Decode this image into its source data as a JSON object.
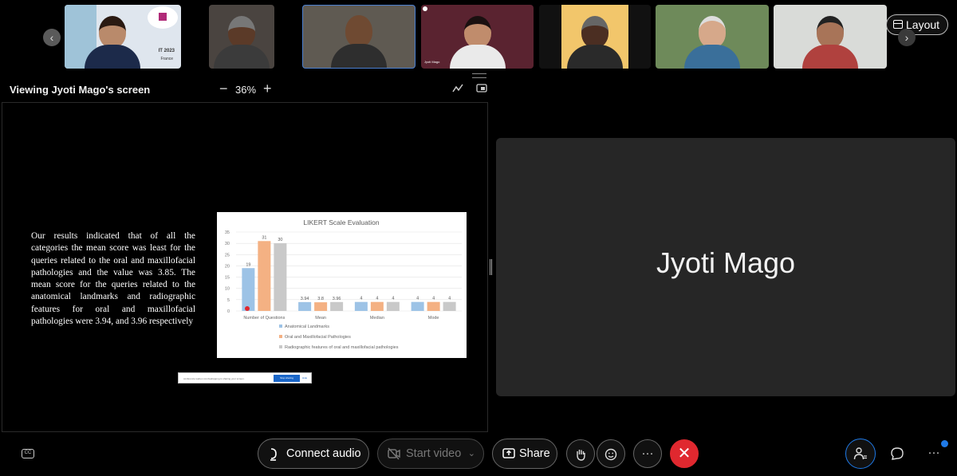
{
  "header": {
    "viewing_label": "Viewing Jyoti Mago's screen",
    "zoom_level": "36%",
    "zoom_minus": "−",
    "zoom_plus": "+",
    "layout_label": "Layout"
  },
  "filmstrip": {
    "prev_glyph": "‹",
    "next_glyph": "›",
    "tiles": [
      {
        "slide_text": "IT 2023",
        "slide_sub": "France"
      },
      {},
      {},
      {
        "caption": "Jyoti Mago"
      },
      {},
      {},
      {}
    ]
  },
  "slide": {
    "body": "Our results indicated that of all the categories the mean score was least for the queries related to the oral and maxillofacial pathologies and the value was 3.85. The mean score for the queries related to the anatomical landmarks and radiographic features for oral and maxillofacial pathologies were 3.94, and 3.96 respectively",
    "notice_text": "conference.webex.com/webappng is sharing your screen.",
    "notice_stop": "Stop sharing",
    "notice_hide": "Hide"
  },
  "chart_data": {
    "type": "bar",
    "title": "LIKERT Scale Evaluation",
    "categories": [
      "Number of Questions",
      "Mean",
      "Median",
      "Mode"
    ],
    "series": [
      {
        "name": "Anatomical Landmarks",
        "color": "#9dc3e6",
        "values": [
          19,
          3.94,
          4,
          4
        ],
        "labels": [
          "19",
          "3.94",
          "4",
          "4"
        ]
      },
      {
        "name": "Oral and Maxillofacial Pathologies",
        "color": "#f4b183",
        "values": [
          31,
          3.85,
          4,
          4
        ],
        "labels": [
          "31",
          "3.8",
          "4",
          "4"
        ]
      },
      {
        "name": "Radiographic features of oral and maxillofacial pathologies",
        "color": "#c9c9c9",
        "values": [
          30,
          3.96,
          4,
          4
        ],
        "labels": [
          "30",
          "3.96",
          "4",
          "4"
        ]
      }
    ],
    "ylim": [
      0,
      35
    ],
    "yticks": [
      "0",
      "5",
      "10",
      "15",
      "20",
      "25",
      "30",
      "35"
    ],
    "grid": true,
    "legend": "bottom"
  },
  "speaker": {
    "name": "Jyoti Mago"
  },
  "controls": {
    "cc_icon": "cc-icon",
    "connect_audio": "Connect audio",
    "start_video": "Start video",
    "share": "Share",
    "more_glyph": "···",
    "end_glyph": "✕",
    "colors": {
      "end": "#e0282f",
      "accent": "#1f7ae8"
    }
  }
}
